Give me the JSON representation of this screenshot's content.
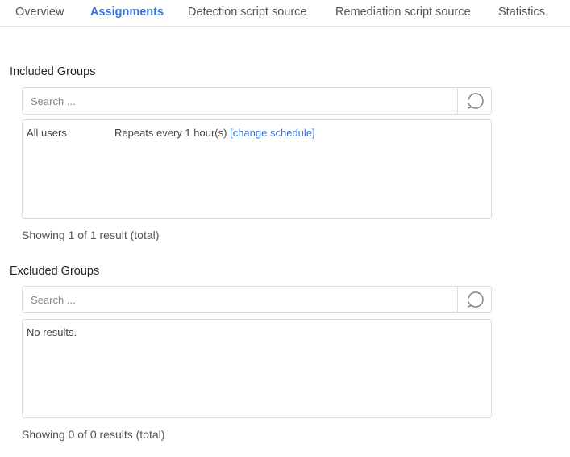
{
  "tabs": [
    {
      "label": "Overview",
      "active": false
    },
    {
      "label": "Assignments",
      "active": true
    },
    {
      "label": "Detection script source",
      "active": false
    },
    {
      "label": "Remediation script source",
      "active": false
    },
    {
      "label": "Statistics",
      "active": false
    }
  ],
  "included": {
    "title": "Included Groups",
    "search_placeholder": "Search ...",
    "rows": [
      {
        "name": "All users",
        "schedule": "Repeats every 1 hour(s)",
        "action": "[change schedule]"
      }
    ],
    "footer": "Showing 1 of 1 result (total)"
  },
  "excluded": {
    "title": "Excluded Groups",
    "search_placeholder": "Search ...",
    "empty_text": "No results.",
    "footer": "Showing 0 of 0 results (total)"
  },
  "colors": {
    "accent": "#3b73d6",
    "border": "#d8dce0"
  },
  "icons": {
    "refresh": "refresh-icon"
  }
}
